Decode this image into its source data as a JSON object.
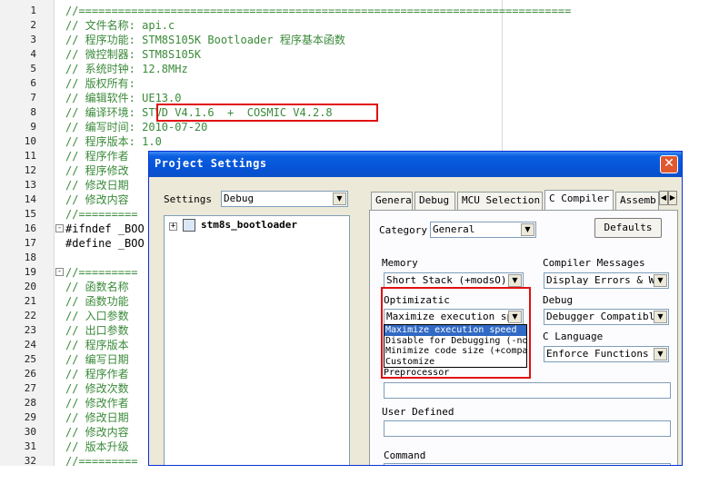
{
  "editor": {
    "line_numbers": [
      "1",
      "2",
      "3",
      "4",
      "5",
      "6",
      "7",
      "8",
      "9",
      "10",
      "11",
      "12",
      "13",
      "14",
      "15",
      "16",
      "17",
      "18",
      "19",
      "20",
      "21",
      "22",
      "23",
      "24",
      "25",
      "26",
      "27",
      "28",
      "29",
      "30",
      "31",
      "32"
    ],
    "lines": [
      "//===========================================================================",
      "// 文件名称: api.c",
      "// 程序功能: STM8S105K Bootloader 程序基本函数",
      "// 微控制器: STM8S105K",
      "// 系统时钟: 12.8MHz",
      "// 版权所有:",
      "// 编辑软件: UE13.0",
      "// 编译环境: STVD V4.1.6  +  COSMIC V4.2.8",
      "// 编写时间: 2010-07-20",
      "// 程序版本: 1.0",
      "// 程序作者",
      "// 程序修改",
      "// 修改日期",
      "// 修改内容",
      "//=========",
      "#ifndef _BOO",
      "#define _BOO",
      "",
      "//=========",
      "// 函数名称",
      "// 函数功能",
      "// 入口参数",
      "// 出口参数",
      "// 程序版本",
      "// 编写日期",
      "// 程序作者",
      "// 修改次数",
      "// 修改作者",
      "// 修改日期",
      "// 修改内容",
      "// 版本升级",
      "//========="
    ],
    "fold_markers": [
      "-",
      "-"
    ]
  },
  "dialog": {
    "title": "Project Settings",
    "close_glyph": "✕",
    "settings_label": "Settings",
    "settings_value": "Debug",
    "tree_expander": "+",
    "tree_root": "stm8s_bootloader",
    "tabs": [
      "General",
      "Debug",
      "MCU Selection",
      "C Compiler",
      "Assemb"
    ],
    "active_tab": "C Compiler",
    "tab_scroll_left": "◀",
    "tab_scroll_right": "▶",
    "category_label": "Category",
    "category_value": "General",
    "defaults_button": "Defaults",
    "memory_label": "Memory",
    "memory_value": "Short Stack (+modsO)",
    "compiler_messages_label": "Compiler Messages",
    "compiler_messages_value": "Display Errors & War",
    "optimization_label": "Optimizatic",
    "optimization_value": "Maximize execution spe",
    "debug_label": "Debug",
    "debug_value": "Debugger Compatible",
    "c_language_label": "C Language",
    "c_language_value": "Enforce Functions Pr",
    "optimization_options": [
      "Maximize execution speed",
      "Disable for Debugging (-no",
      "Minimize code size (+compa",
      "Customize"
    ],
    "selected_option": "Maximize execution speed",
    "preprocessor_label": "Preprocessor",
    "user_defined_label": "User Defined",
    "command_label": "Command",
    "combo_arrow": "▼"
  },
  "colors": {
    "comment": "#3a8a3a",
    "highlight_box": "#e01010",
    "titlebar": "#0554d8",
    "selection": "#316ac5"
  }
}
